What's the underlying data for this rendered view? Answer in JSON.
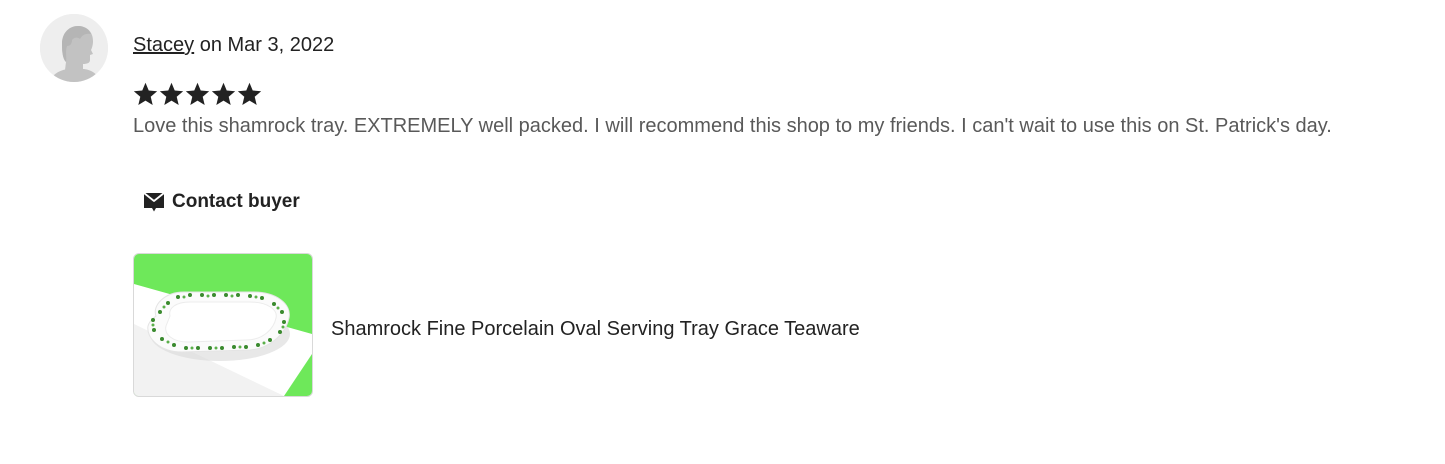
{
  "review": {
    "reviewer_name": "Stacey",
    "date_text": " on Mar 3, 2022",
    "rating": 5,
    "rating_max": 5,
    "text": "Love this shamrock tray. EXTREMELY well packed. I will recommend this shop to my friends. I can't wait to use this on St. Patrick's day."
  },
  "actions": {
    "contact_label": "Contact buyer",
    "contact_icon": "message-icon"
  },
  "product": {
    "title": "Shamrock Fine Porcelain Oval Serving Tray Grace Teaware",
    "thumb_bg_color": "#6ee85a"
  },
  "colors": {
    "star": "#222222",
    "text_primary": "#222222",
    "text_secondary": "#595959"
  }
}
